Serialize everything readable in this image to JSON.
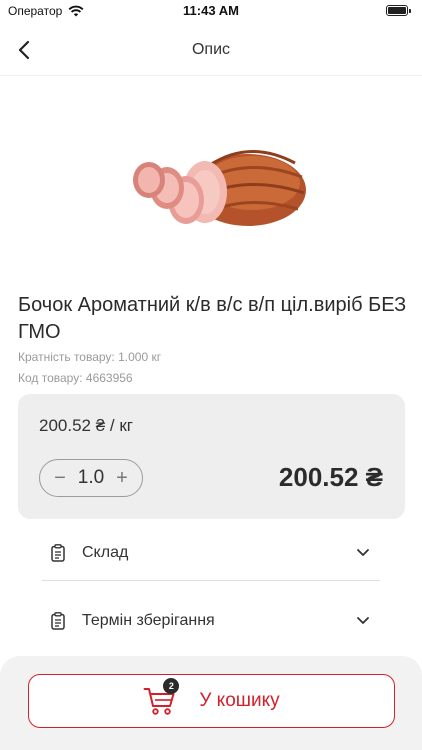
{
  "status_bar": {
    "carrier": "Оператор",
    "time": "11:43 AM"
  },
  "nav": {
    "title": "Опис",
    "back_icon": "chevron-left-icon"
  },
  "product": {
    "image_subject": "smoked pork roll",
    "title": "Бочок Ароматний к/в в/с в/п ціл.виріб БЕЗ ГМО",
    "multiplicity": "Кратність товару: 1.000 кг",
    "code": "Код товару: 4663956"
  },
  "pricing": {
    "unit_price": "200.52 ₴ / кг",
    "quantity": "1.0",
    "total": "200.52 ₴",
    "minus_symbol": "−",
    "plus_symbol": "+"
  },
  "accordion": [
    {
      "label": "Склад",
      "icon": "document-icon"
    },
    {
      "label": "Термін зберігання",
      "icon": "document-icon"
    }
  ],
  "cart": {
    "label": "У кошику",
    "badge": "2",
    "icon": "cart-icon"
  },
  "colors": {
    "accent": "#d3202a",
    "card_bg": "#eeeeee",
    "bottom_bg": "#f2f2f2"
  }
}
